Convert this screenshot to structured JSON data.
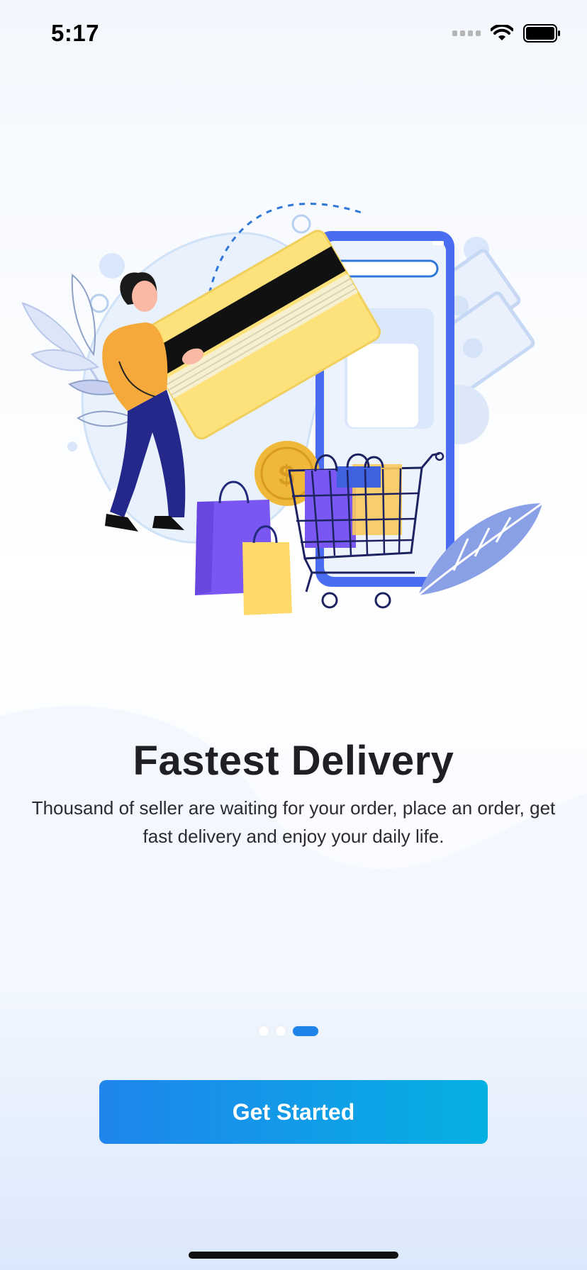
{
  "status_bar": {
    "time": "5:17",
    "icons": [
      "signal-icon",
      "wifi-icon",
      "battery-icon"
    ]
  },
  "onboarding": {
    "title": "Fastest Delivery",
    "description": "Thousand of seller are waiting for your order, place an order, get fast delivery and enjoy your daily life.",
    "page_indicator": {
      "total": 3,
      "active_index": 2
    },
    "cta_label": "Get Started"
  },
  "colors": {
    "accent": "#1f84ea",
    "button_gradient_start": "#1f85ec",
    "button_gradient_end": "#05b0e3",
    "title": "#1f1f24"
  }
}
